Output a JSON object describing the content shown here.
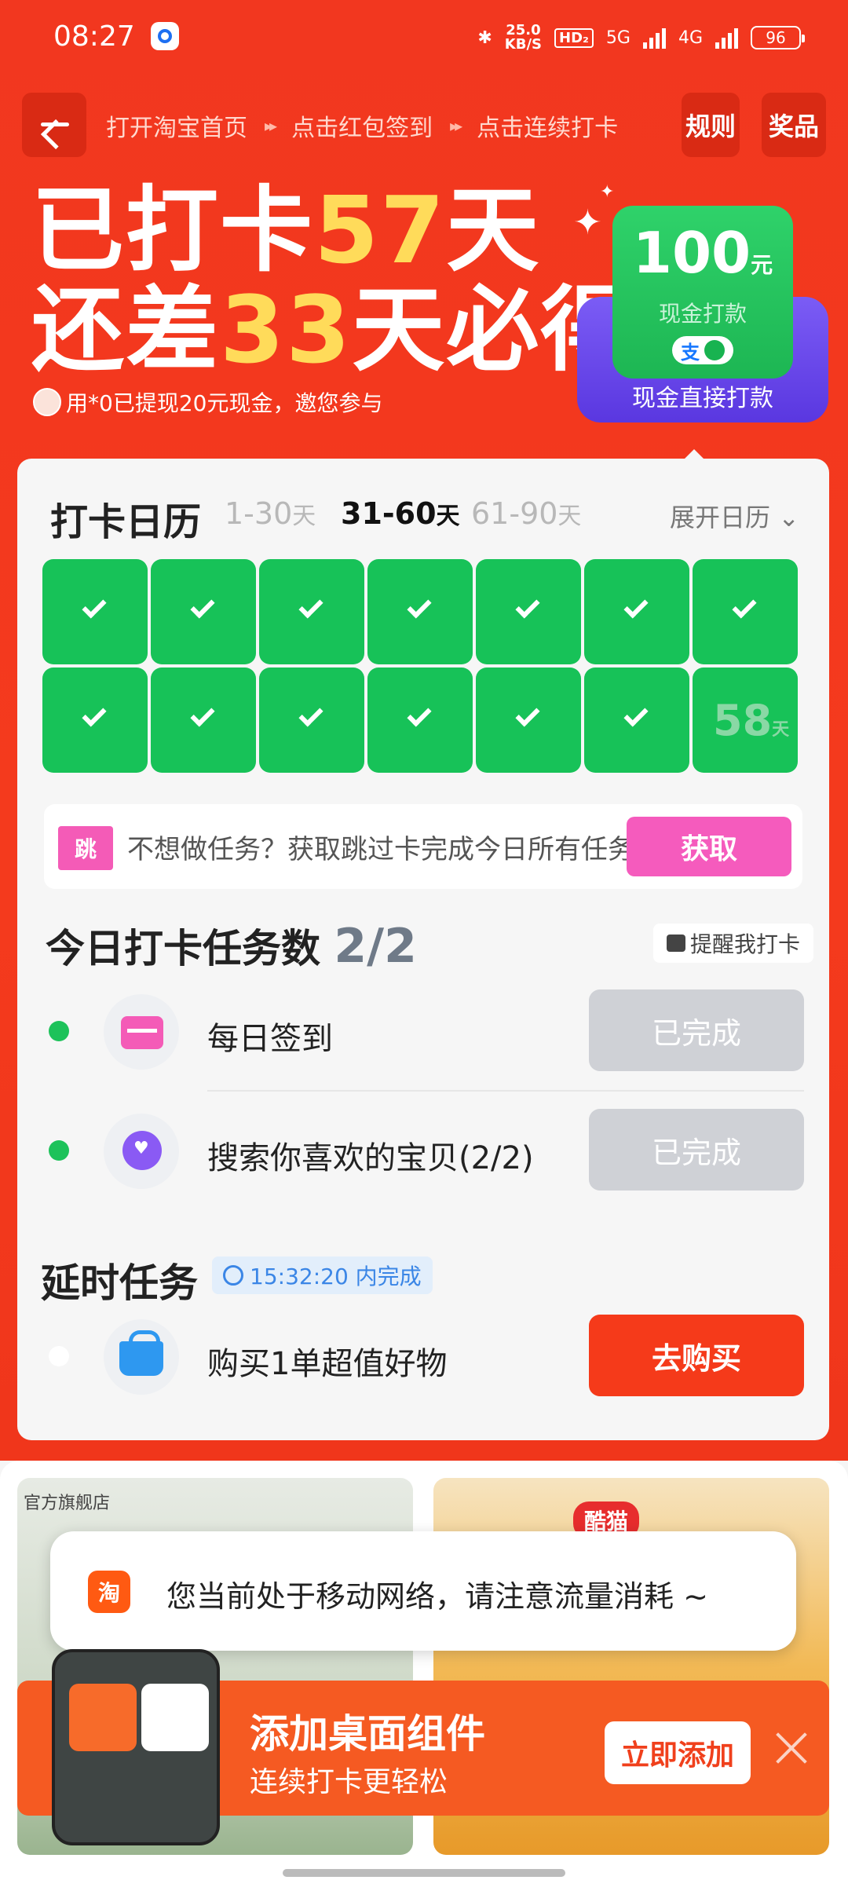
{
  "status": {
    "time": "08:27",
    "net_speed": "25.0",
    "net_unit": "KB/S",
    "hd": "HD₂",
    "sig1": "5G",
    "sig2": "4G",
    "battery": "96"
  },
  "nav": {
    "steps": [
      "打开淘宝首页",
      "点击红包签到",
      "点击连续打卡"
    ],
    "arrow": "▸▸",
    "rules": "规则",
    "prize": "奖品"
  },
  "hero": {
    "line1_a": "已打卡",
    "line1_num": "57",
    "line1_b": "天",
    "line2_a": "还差",
    "line2_num": "33",
    "line2_b": "天必得",
    "sub": "用*0已提现20元现金，邀您参与"
  },
  "reward": {
    "amount": "100",
    "unit": "元",
    "label": "现金打款",
    "pay": "支",
    "caption": "现金直接打款"
  },
  "calendar": {
    "title": "打卡日历",
    "ranges": [
      {
        "num": "1-30",
        "unit": "天"
      },
      {
        "num": "31-60",
        "unit": "天"
      },
      {
        "num": "61-90",
        "unit": "天"
      }
    ],
    "expand": "展开日历",
    "checked_days": 13,
    "today": {
      "num": "58",
      "unit": "天"
    }
  },
  "skip": {
    "tag": "跳",
    "text": "不想做任务？获取跳过卡完成今日所有任务",
    "button": "获取"
  },
  "tasks": {
    "title": "今日打卡任务数",
    "count": "2/2",
    "remind": "提醒我打卡",
    "items": [
      {
        "name": "每日签到",
        "status": "已完成"
      },
      {
        "name": "搜索你喜欢的宝贝(2/2)",
        "status": "已完成"
      }
    ]
  },
  "delay": {
    "title": "延时任务",
    "timer": "15:32:20 内完成",
    "task": "购买1单超值好物",
    "button": "去购买"
  },
  "feed": {
    "brand": "官方旗舰店",
    "brand2": "酷猫"
  },
  "toast": {
    "logo": "淘",
    "message": "您当前处于移动网络，请注意流量消耗 ~"
  },
  "widget": {
    "title": "添加桌面组件",
    "subtitle": "连续打卡更轻松",
    "button": "立即添加"
  },
  "colors": {
    "primary": "#f2371f",
    "green": "#17c258",
    "pink": "#f55bbd",
    "purple": "#6a49ec",
    "yellow": "#ffdb5a"
  }
}
